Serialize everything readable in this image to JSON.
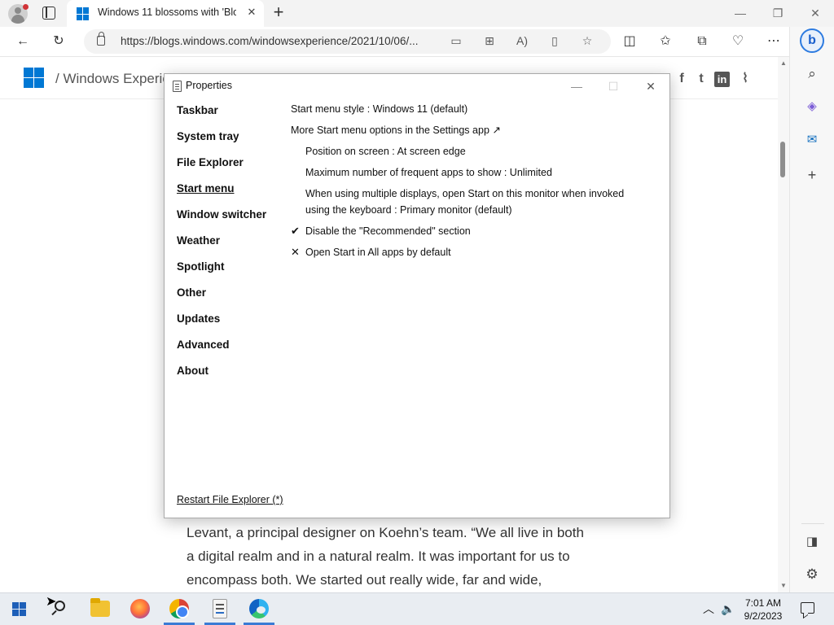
{
  "browser": {
    "tab": {
      "title": "Windows 11 blossoms with 'Blo",
      "close": "✕"
    },
    "new_tab": "+",
    "window_controls": {
      "minimize": "—",
      "restore": "❐",
      "close": "✕"
    },
    "nav": {
      "back": "←",
      "refresh": "↻"
    },
    "url": "https://blogs.windows.com/windowsexperience/2021/10/06/...",
    "address_icons": {
      "read_aloud": "A)",
      "favorite": "☆"
    },
    "toolbar_icons": {
      "more": "⋯"
    },
    "sidebar": {
      "bing": "b",
      "search": "⌕",
      "add": "+",
      "settings": "⚙"
    }
  },
  "page": {
    "site_name": "/ Windows Experien",
    "social": {
      "facebook": "f",
      "twitter": "t",
      "linkedin": "in",
      "rss": "⌇"
    },
    "article_lines": [
      "Levant, a principal designer on Koehn’s team. “We all live in both",
      "a digital realm and in a natural realm. It was important for us to",
      "encompass both. We started out really wide, far and wide,"
    ]
  },
  "dialog": {
    "title": "Properties",
    "controls": {
      "minimize": "—",
      "maximize": "☐",
      "close": "✕"
    },
    "nav_items": [
      "Taskbar",
      "System tray",
      "File Explorer",
      "Start menu",
      "Window switcher",
      "Weather",
      "Spotlight",
      "Other",
      "Updates",
      "Advanced",
      "About"
    ],
    "active_nav": "Start menu",
    "options": {
      "start_style": "Start menu style : Windows 11 (default)",
      "more_options": "More Start menu options in the Settings app ↗",
      "position": "Position on screen : At screen edge",
      "max_frequent": "Maximum number of frequent apps to show : Unlimited",
      "multi_display": "When using multiple displays, open Start on this monitor when invoked using the keyboard : Primary monitor (default)",
      "disable_recommended": {
        "mark": "✔",
        "label": "Disable the \"Recommended\" section"
      },
      "open_all_apps": {
        "mark": "✕",
        "label": "Open Start in All apps by default"
      }
    },
    "restart_link": "Restart File Explorer (*)"
  },
  "taskbar": {
    "clock": {
      "time": "7:01 AM",
      "date": "9/2/2023"
    },
    "tray": {
      "chevron": "︿",
      "volume": "🔈"
    }
  }
}
